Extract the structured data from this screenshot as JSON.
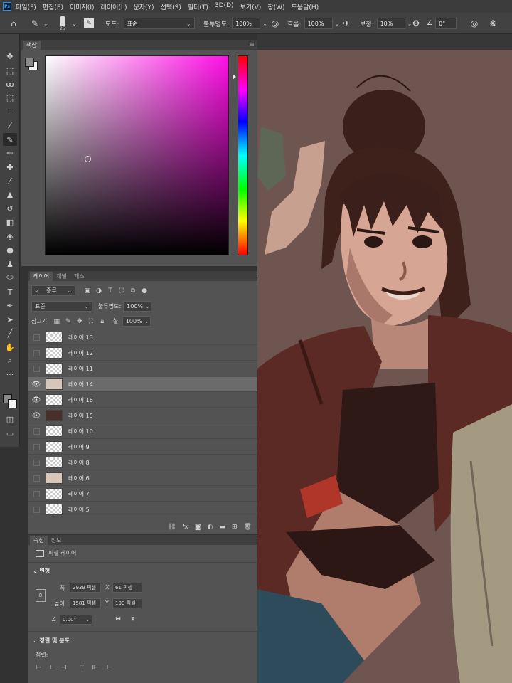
{
  "menubar": {
    "logo": "Ps",
    "items": [
      "파일(F)",
      "편집(E)",
      "이미지(I)",
      "레이어(L)",
      "문자(Y)",
      "선택(S)",
      "필터(T)",
      "3D(D)",
      "보기(V)",
      "창(W)",
      "도움말(H)"
    ]
  },
  "options": {
    "brush_size": "25",
    "mode_label": "모드:",
    "mode_value": "표준",
    "opacity_label": "불투명도:",
    "opacity_value": "100%",
    "flow_label": "흐름:",
    "flow_value": "100%",
    "smoothing_label": "보정:",
    "smoothing_value": "10%",
    "angle_value": "0°"
  },
  "color_panel": {
    "tab": "색상",
    "foreground": "#8a8a8a",
    "background": "#f2f2f2",
    "hue_color": "#ff10e6"
  },
  "layers_panel": {
    "tabs": [
      "레이어",
      "채널",
      "패스"
    ],
    "filter_kind": "종류",
    "blend_mode": "표준",
    "opacity_label": "불투명도:",
    "opacity_value": "100%",
    "lock_label": "잠그기:",
    "fill_label": "칠:",
    "fill_value": "100%",
    "layers": [
      {
        "name": "레이어 13",
        "visible": false,
        "thumb": "transparent",
        "selected": false
      },
      {
        "name": "레이어 12",
        "visible": false,
        "thumb": "transparent",
        "selected": false
      },
      {
        "name": "레이어 11",
        "visible": false,
        "thumb": "transparent",
        "selected": false
      },
      {
        "name": "레이어 14",
        "visible": true,
        "thumb": "figure",
        "selected": true
      },
      {
        "name": "레이어 16",
        "visible": true,
        "thumb": "transparent",
        "selected": false
      },
      {
        "name": "레이어 15",
        "visible": true,
        "thumb": "dark",
        "selected": false
      },
      {
        "name": "레이어 10",
        "visible": false,
        "thumb": "transparent",
        "selected": false
      },
      {
        "name": "레이어 9",
        "visible": false,
        "thumb": "transparent",
        "selected": false
      },
      {
        "name": "레이어 8",
        "visible": false,
        "thumb": "transparent",
        "selected": false
      },
      {
        "name": "레이어 6",
        "visible": false,
        "thumb": "figure",
        "selected": false
      },
      {
        "name": "레이어 7",
        "visible": false,
        "thumb": "transparent",
        "selected": false
      },
      {
        "name": "레이어 5",
        "visible": false,
        "thumb": "transparent",
        "selected": false
      }
    ]
  },
  "properties": {
    "tabs": [
      "속성",
      "정보"
    ],
    "layer_type": "픽셀 레이어",
    "transform_title": "변형",
    "w_label": "폭",
    "w_value": "2939 픽셀",
    "x_label": "X",
    "x_value": "61 픽셀",
    "h_label": "높이",
    "h_value": "1581 픽셀",
    "y_label": "Y",
    "y_value": "190 픽셀",
    "angle_value": "0.00°",
    "align_title": "정렬 및 분포",
    "align_label": "정렬:"
  },
  "colors": {
    "ui_dark": "#323232",
    "panel": "#535353",
    "canvas_bg": "#6e5550",
    "selected_layer": "#6b6b6b"
  }
}
